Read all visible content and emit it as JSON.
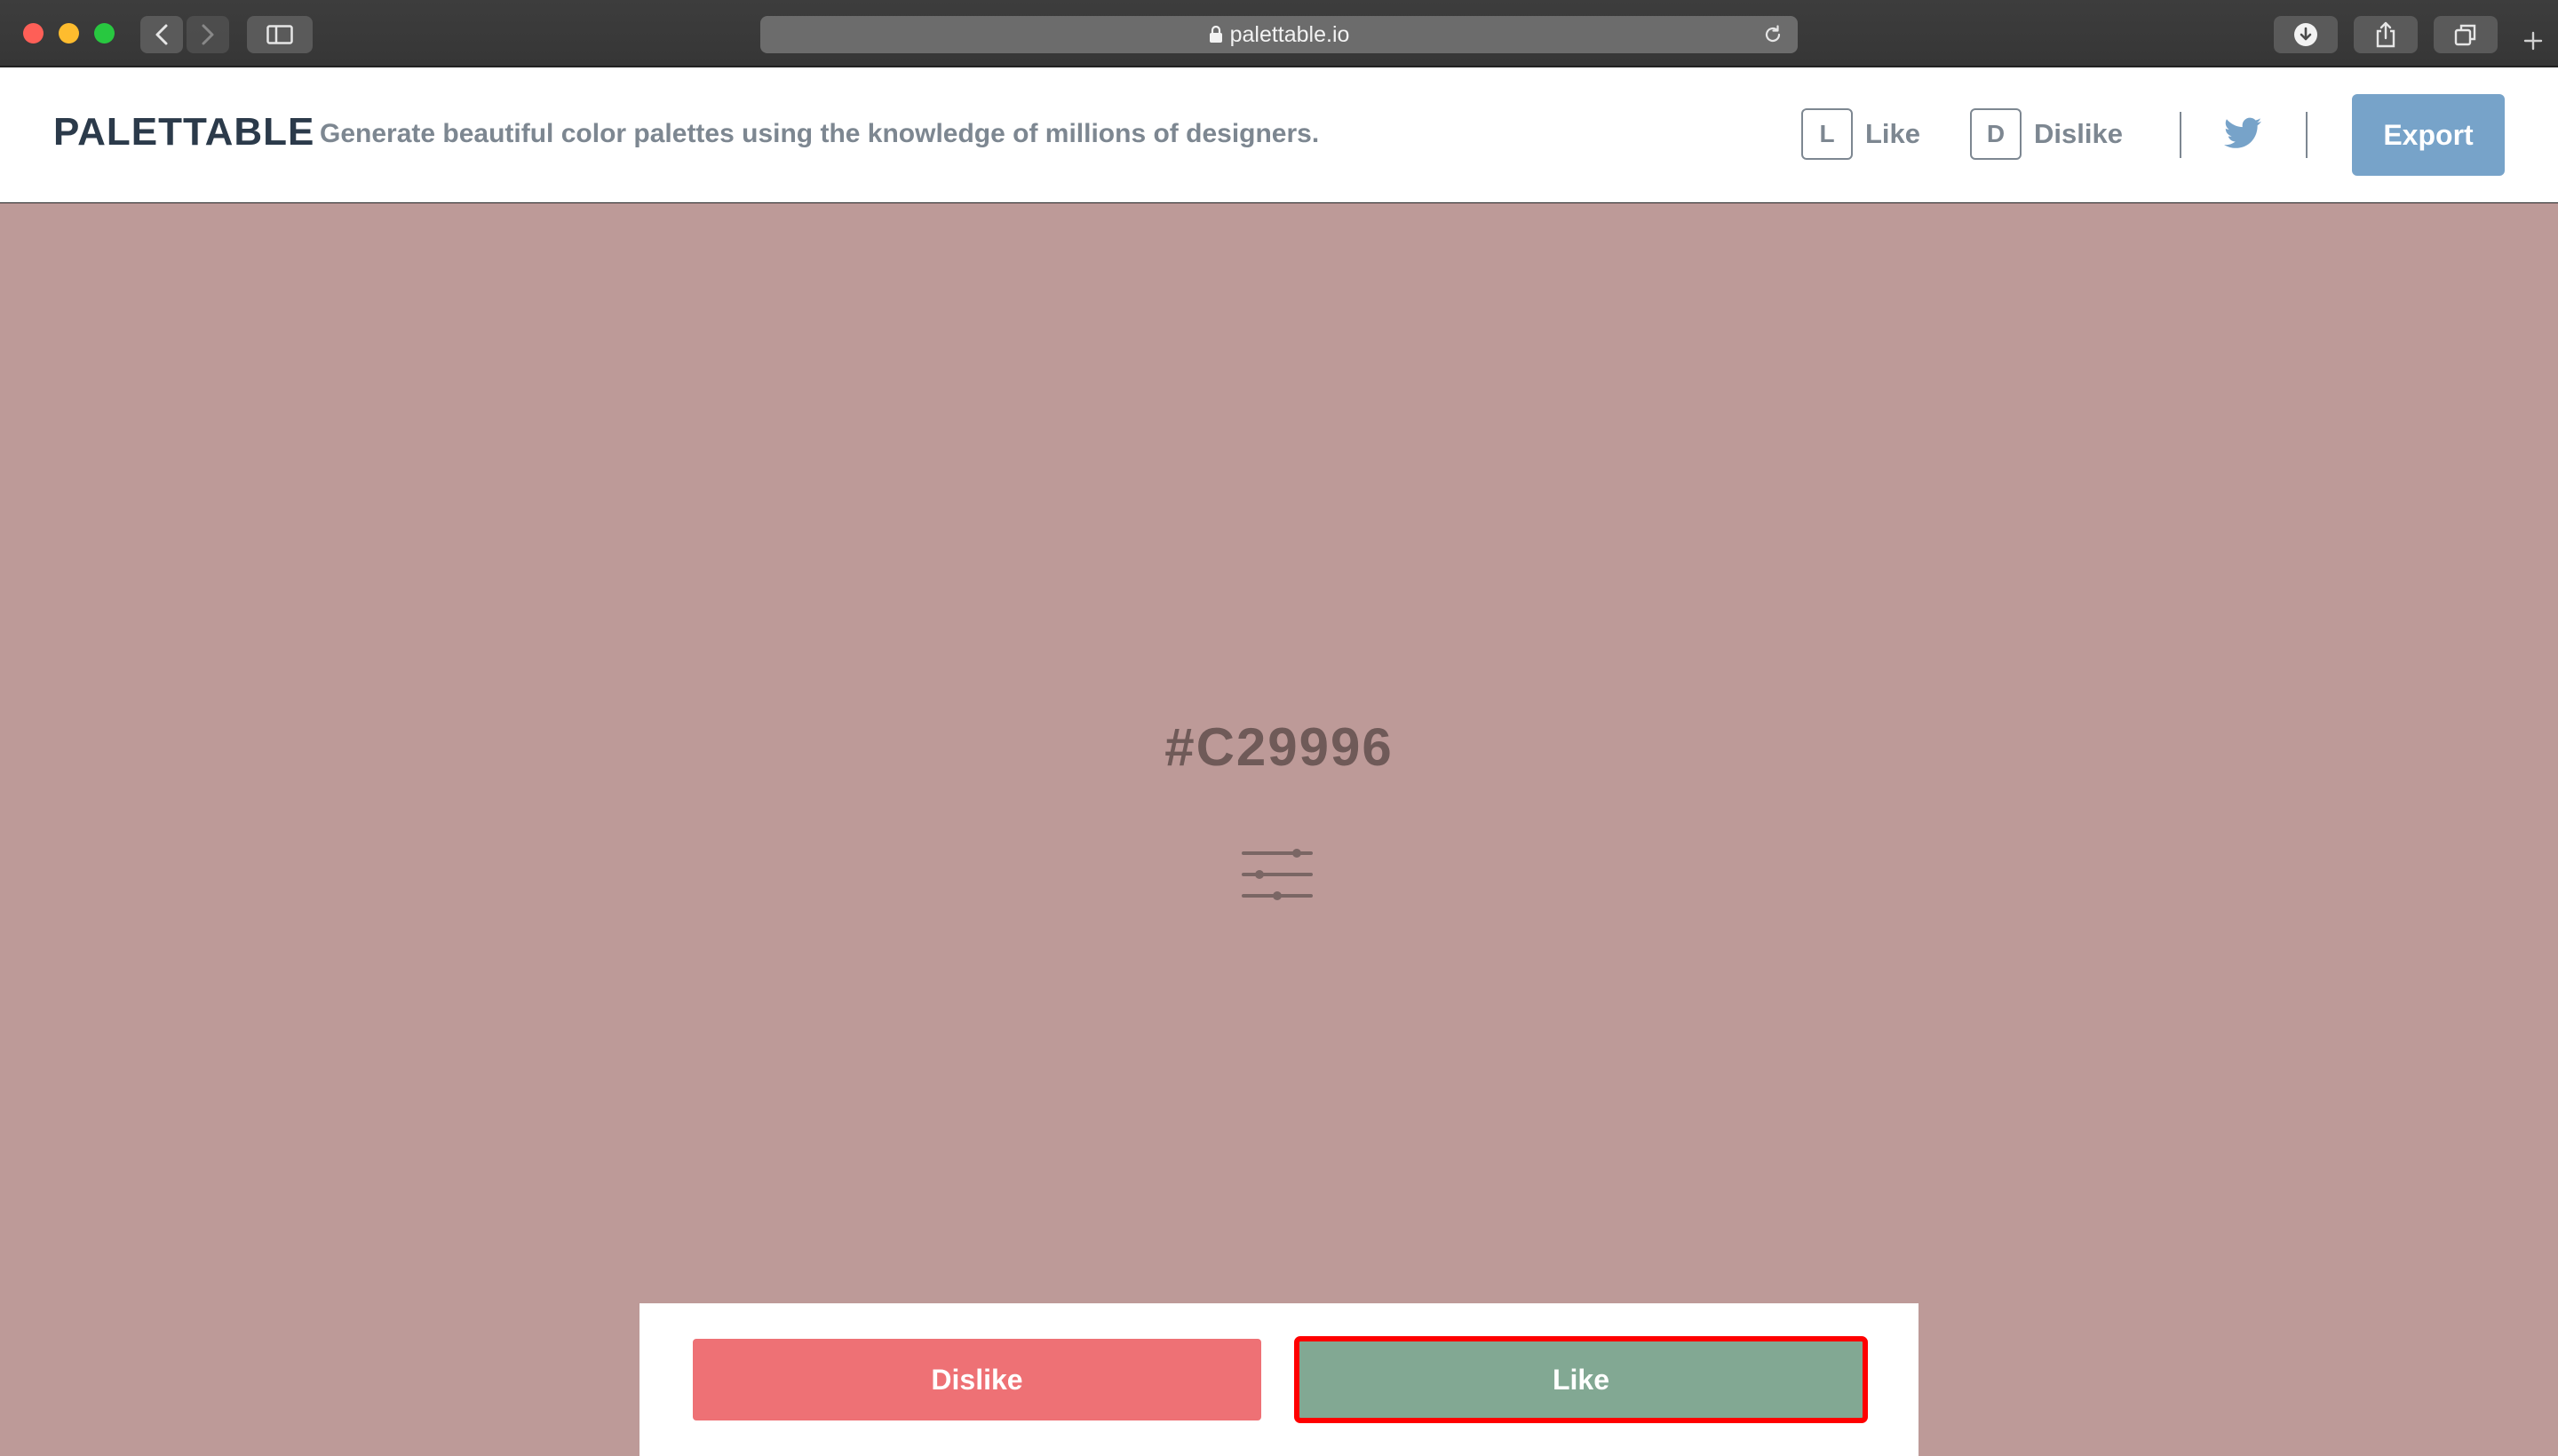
{
  "browser": {
    "url": "palettable.io",
    "icons": {
      "back": "chevron-left-icon",
      "forward": "chevron-right-icon",
      "sidebar": "sidebar-icon",
      "lock": "lock-icon",
      "reload": "reload-icon",
      "download": "download-icon",
      "share": "share-icon",
      "tabs": "tabs-icon",
      "new_tab": "plus-icon"
    }
  },
  "header": {
    "logo": "PALETTABLE",
    "tagline": "Generate beautiful color palettes using the knowledge of millions of designers.",
    "like_key": "L",
    "like_label": "Like",
    "dislike_key": "D",
    "dislike_label": "Dislike",
    "twitter_icon": "twitter-icon",
    "export_label": "Export"
  },
  "palette": {
    "hex": "#C29996",
    "background_color": "#bd9a98",
    "adjust_icon": "sliders-icon"
  },
  "actions": {
    "dislike_label": "Dislike",
    "like_label": "Like",
    "dislike_color": "#ee7175",
    "like_color": "#82a893"
  },
  "colors": {
    "accent": "#77a3c9",
    "text_dark": "#2b3a4a",
    "text_muted": "#7d8791"
  }
}
